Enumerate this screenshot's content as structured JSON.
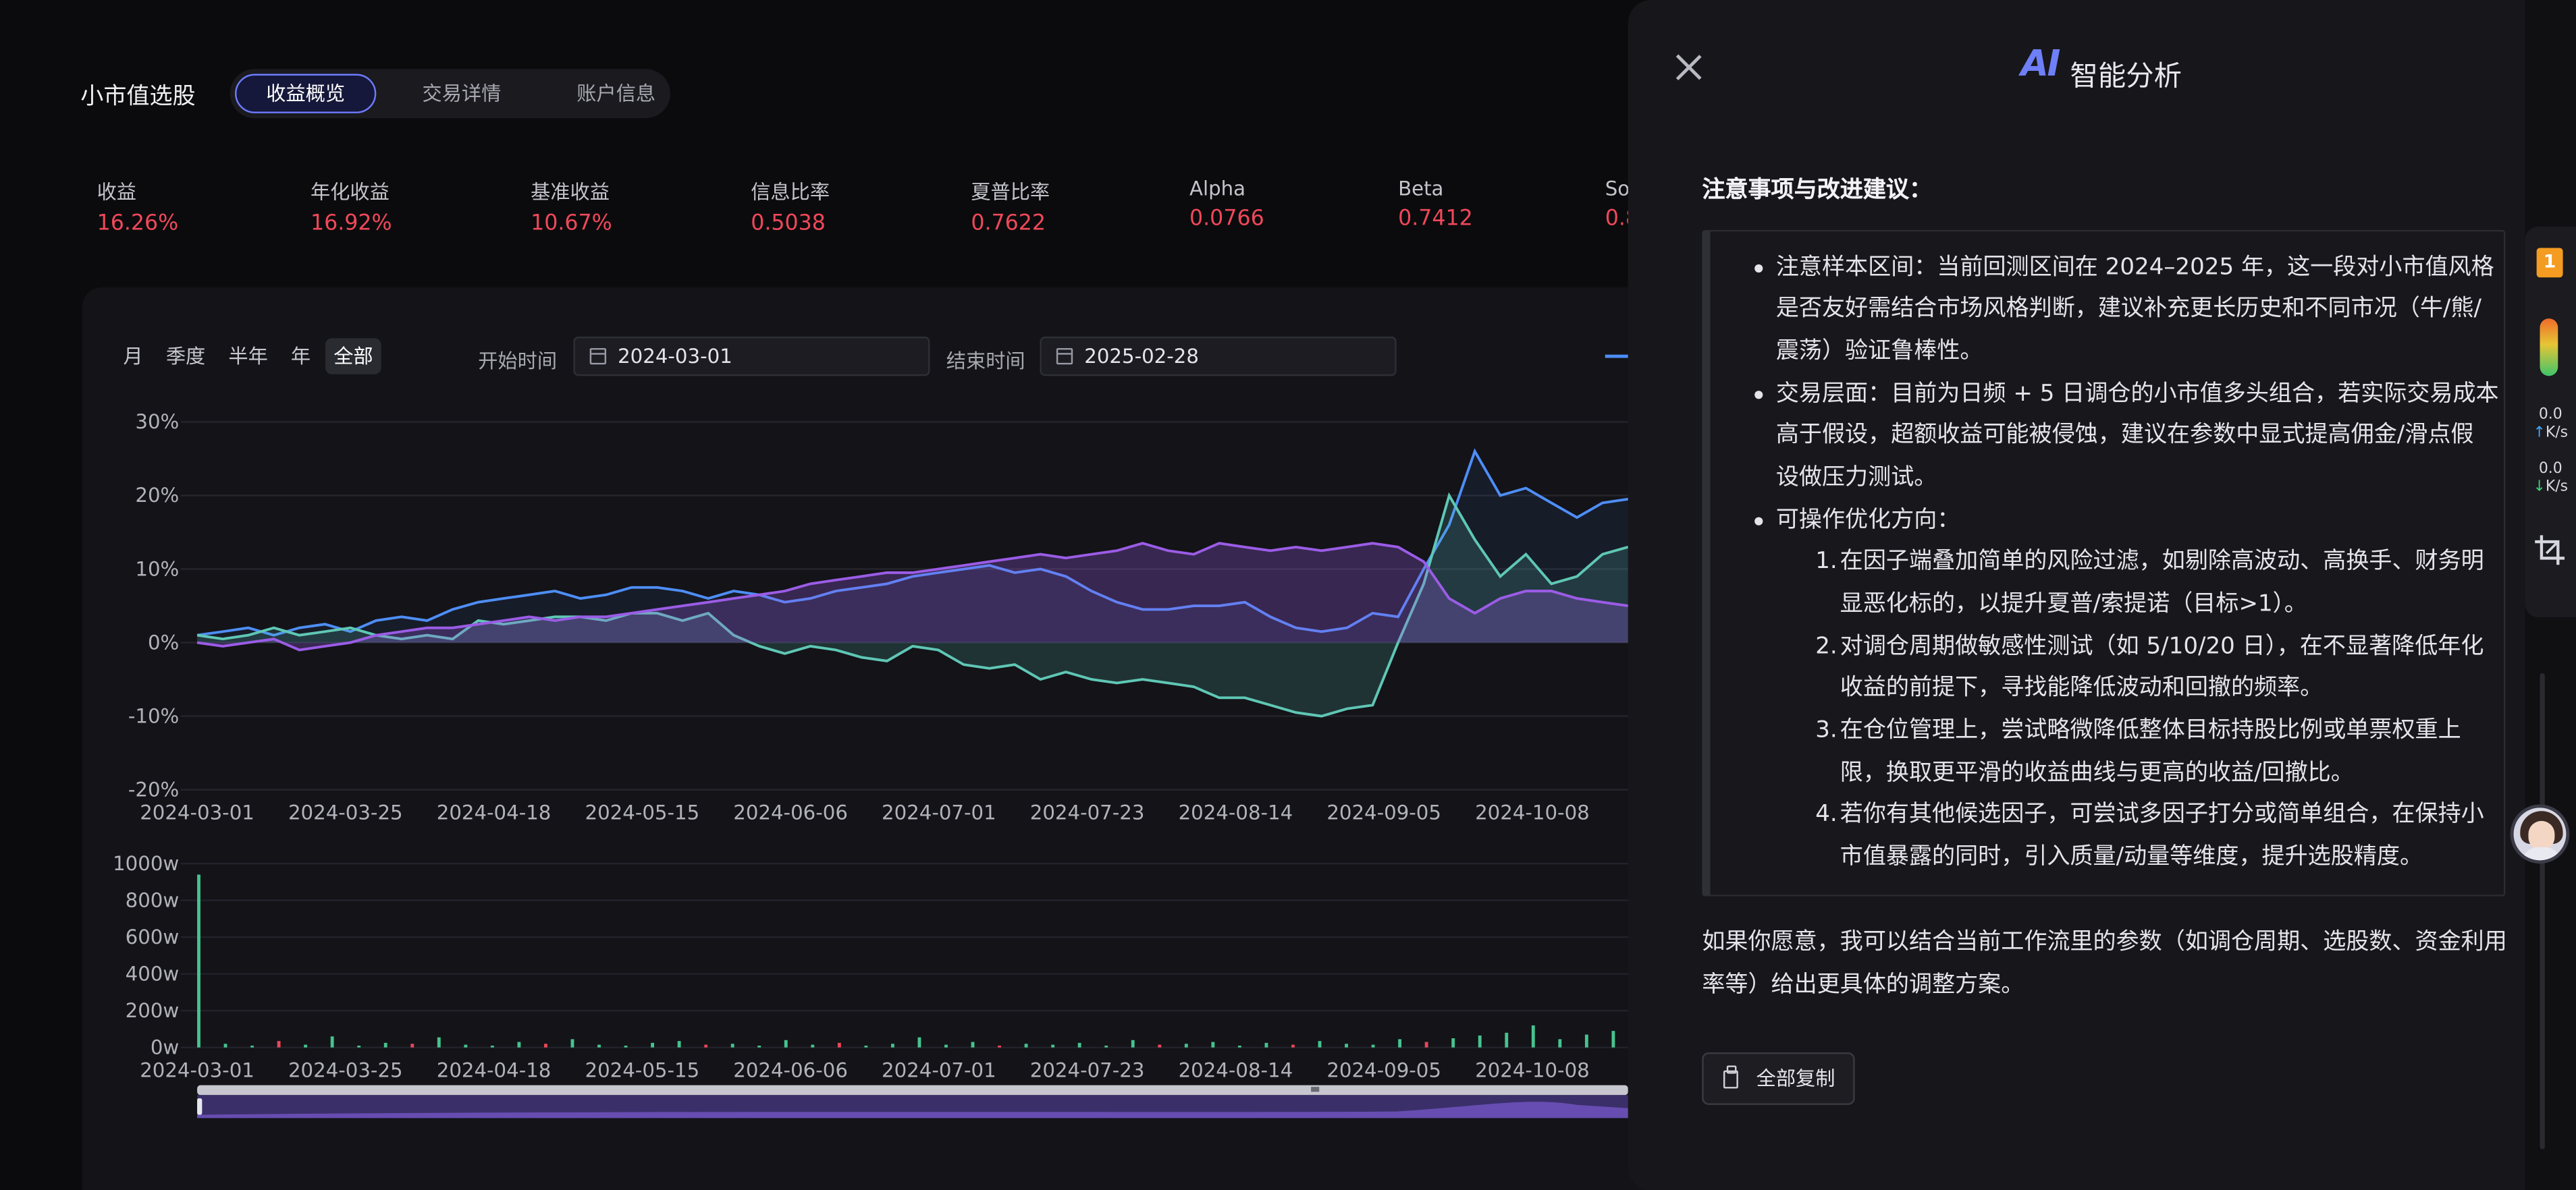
{
  "app_title": "小市值选股",
  "tabs": [
    {
      "label": "收益概览",
      "active": true
    },
    {
      "label": "交易详情",
      "active": false
    },
    {
      "label": "账户信息",
      "active": false
    }
  ],
  "metrics": [
    {
      "label": "收益",
      "value": "16.26%"
    },
    {
      "label": "年化收益",
      "value": "16.92%"
    },
    {
      "label": "基准收益",
      "value": "10.67%"
    },
    {
      "label": "信息比率",
      "value": "0.5038"
    },
    {
      "label": "夏普比率",
      "value": "0.7622"
    },
    {
      "label": "Alpha",
      "value": "0.0766"
    },
    {
      "label": "Beta",
      "value": "0.7412"
    },
    {
      "label": "So",
      "value": "0.8"
    }
  ],
  "period_buttons": [
    {
      "label": "月",
      "active": false
    },
    {
      "label": "季度",
      "active": false
    },
    {
      "label": "半年",
      "active": false
    },
    {
      "label": "年",
      "active": false
    },
    {
      "label": "全部",
      "active": true
    }
  ],
  "date_range": {
    "start_label": "开始时间",
    "start_value": "2024-03-01",
    "end_label": "结束时间",
    "end_value": "2025-02-28"
  },
  "colors": {
    "accent": "#6d7bff",
    "positive": "#f0485a",
    "strategy_line": "#4e8ef7",
    "excess_line": "#5fc7b5",
    "benchmark_line": "#9b5ce6",
    "volume_up": "#46c38e",
    "volume_down": "#e8475a"
  },
  "chart_data": [
    {
      "type": "line",
      "yunit": "%",
      "ylim": [
        -20,
        30
      ],
      "yticks": [
        "30%",
        "20%",
        "10%",
        "0%",
        "-10%",
        "-20%"
      ],
      "xticks": [
        "2024-03-01",
        "2024-03-25",
        "2024-04-18",
        "2024-05-15",
        "2024-06-06",
        "2024-07-01",
        "2024-07-23",
        "2024-08-14",
        "2024-09-05",
        "2024-10-08"
      ],
      "grid": true,
      "series": [
        {
          "values": [
            1,
            1.5,
            2,
            1,
            2,
            2.5,
            1.5,
            3,
            3.5,
            3,
            4.5,
            5.5,
            6,
            6.5,
            7,
            6,
            6.5,
            7.5,
            7.5,
            7,
            6,
            7,
            6.5,
            5.5,
            6,
            7,
            7.5,
            8,
            9,
            9.5,
            10,
            10.5,
            9.5,
            10,
            9,
            7,
            5.5,
            4.5,
            4.5,
            5,
            5,
            5.5,
            3.5,
            2,
            1.5,
            2,
            4,
            3.5,
            10,
            16,
            26,
            20,
            21,
            19,
            17,
            19,
            19.5
          ]
        },
        {
          "values": [
            1,
            0.5,
            1,
            2,
            1,
            1.5,
            2,
            1,
            0.5,
            1,
            0.5,
            3,
            2.5,
            3,
            3.5,
            3.5,
            3,
            4,
            4,
            3,
            4,
            1,
            -0.5,
            -1.5,
            -0.5,
            -1,
            -2,
            -2.5,
            -0.5,
            -1,
            -3,
            -3.5,
            -3,
            -5,
            -4,
            -5,
            -5.5,
            -5,
            -5.5,
            -6,
            -7.5,
            -7.5,
            -8.5,
            -9.5,
            -10,
            -9,
            -8.5,
            0,
            8,
            20,
            14,
            9,
            12,
            8,
            9,
            12,
            13
          ]
        },
        {
          "values": [
            0,
            -0.5,
            0,
            0.5,
            -1,
            -0.5,
            0,
            1,
            1.5,
            2,
            2,
            2.5,
            3,
            3.5,
            3,
            3.5,
            3.5,
            4,
            4.5,
            5,
            5.5,
            6,
            6.5,
            7,
            8,
            8.5,
            9,
            9.5,
            9.5,
            10,
            10.5,
            11,
            11.5,
            12,
            11.5,
            12,
            12.5,
            13.5,
            12.5,
            12,
            13.5,
            13,
            12.5,
            13,
            12.5,
            13,
            13.5,
            13,
            11,
            6,
            4,
            6,
            7,
            7,
            6,
            5.5,
            5
          ]
        }
      ]
    },
    {
      "type": "bar",
      "yunit": "w",
      "ylim": [
        0,
        1000
      ],
      "yticks": [
        "1000w",
        "800w",
        "600w",
        "400w",
        "200w",
        "0w"
      ],
      "xticks": [
        "2024-03-01",
        "2024-03-25",
        "2024-04-18",
        "2024-05-15",
        "2024-06-06",
        "2024-07-01",
        "2024-07-23",
        "2024-08-14",
        "2024-09-05",
        "2024-10-08"
      ],
      "values": [
        940,
        20,
        10,
        35,
        15,
        60,
        10,
        25,
        20,
        55,
        15,
        10,
        30,
        20,
        45,
        15,
        10,
        25,
        35,
        15,
        20,
        10,
        40,
        15,
        25,
        10,
        20,
        55,
        15,
        30,
        10,
        20,
        15,
        25,
        10,
        40,
        15,
        20,
        30,
        10,
        25,
        15,
        35,
        20,
        15,
        45,
        30,
        50,
        65,
        80,
        120,
        45,
        70,
        90
      ],
      "down": [
        3,
        8,
        13,
        19,
        24,
        30,
        36,
        41,
        46
      ],
      "grid": true
    }
  ],
  "drawer": {
    "logo": "AI",
    "title": "智能分析",
    "heading": "注意事项与改进建议：",
    "bullets": [
      {
        "lines": [
          "注意样本区间：当前回测区间在 2024–2025 年，这一段对小市值风格",
          "是否友好需结合市场风格判断，建议补充更长历史和不同市况（牛/熊/",
          "震荡）验证鲁棒性。"
        ]
      },
      {
        "lines": [
          "交易层面：目前为日频 + 5 日调仓的小市值多头组合，若实际交易成本",
          "高于假设，超额收益可能被侵蚀，建议在参数中显式提高佣金/滑点假",
          "设做压力测试。"
        ]
      },
      {
        "lines": [
          "可操作优化方向："
        ]
      }
    ],
    "numbered": [
      {
        "num": "1.",
        "lines": [
          "在因子端叠加简单的风险过滤，如剔除高波动、高换手、财务明",
          "显恶化标的，以提升夏普/索提诺（目标>1）。"
        ]
      },
      {
        "num": "2.",
        "lines": [
          "对调仓周期做敏感性测试（如 5/10/20 日），在不显著降低年化",
          "收益的前提下，寻找能降低波动和回撤的频率。"
        ]
      },
      {
        "num": "3.",
        "lines": [
          "在仓位管理上，尝试略微降低整体目标持股比例或单票权重上",
          "限，换取更平滑的收益曲线与更高的收益/回撤比。"
        ]
      },
      {
        "num": "4.",
        "lines": [
          "若你有其他候选因子，可尝试多因子打分或简单组合，在保持小",
          "市值暴露的同时，引入质量/动量等维度，提升选股精度。"
        ]
      }
    ],
    "footer_text": [
      "如果你愿意，我可以结合当前工作流里的参数（如调仓周期、选股数、资金利用",
      "率等）给出更具体的调整方案。"
    ],
    "copy_button": "全部复制"
  },
  "sidebar": {
    "badge": "1",
    "upload_value": "0.0",
    "upload_unit": "K/s",
    "download_value": "0.0",
    "download_unit": "K/s",
    "up_arrow": "↑",
    "down_arrow": "↓"
  }
}
